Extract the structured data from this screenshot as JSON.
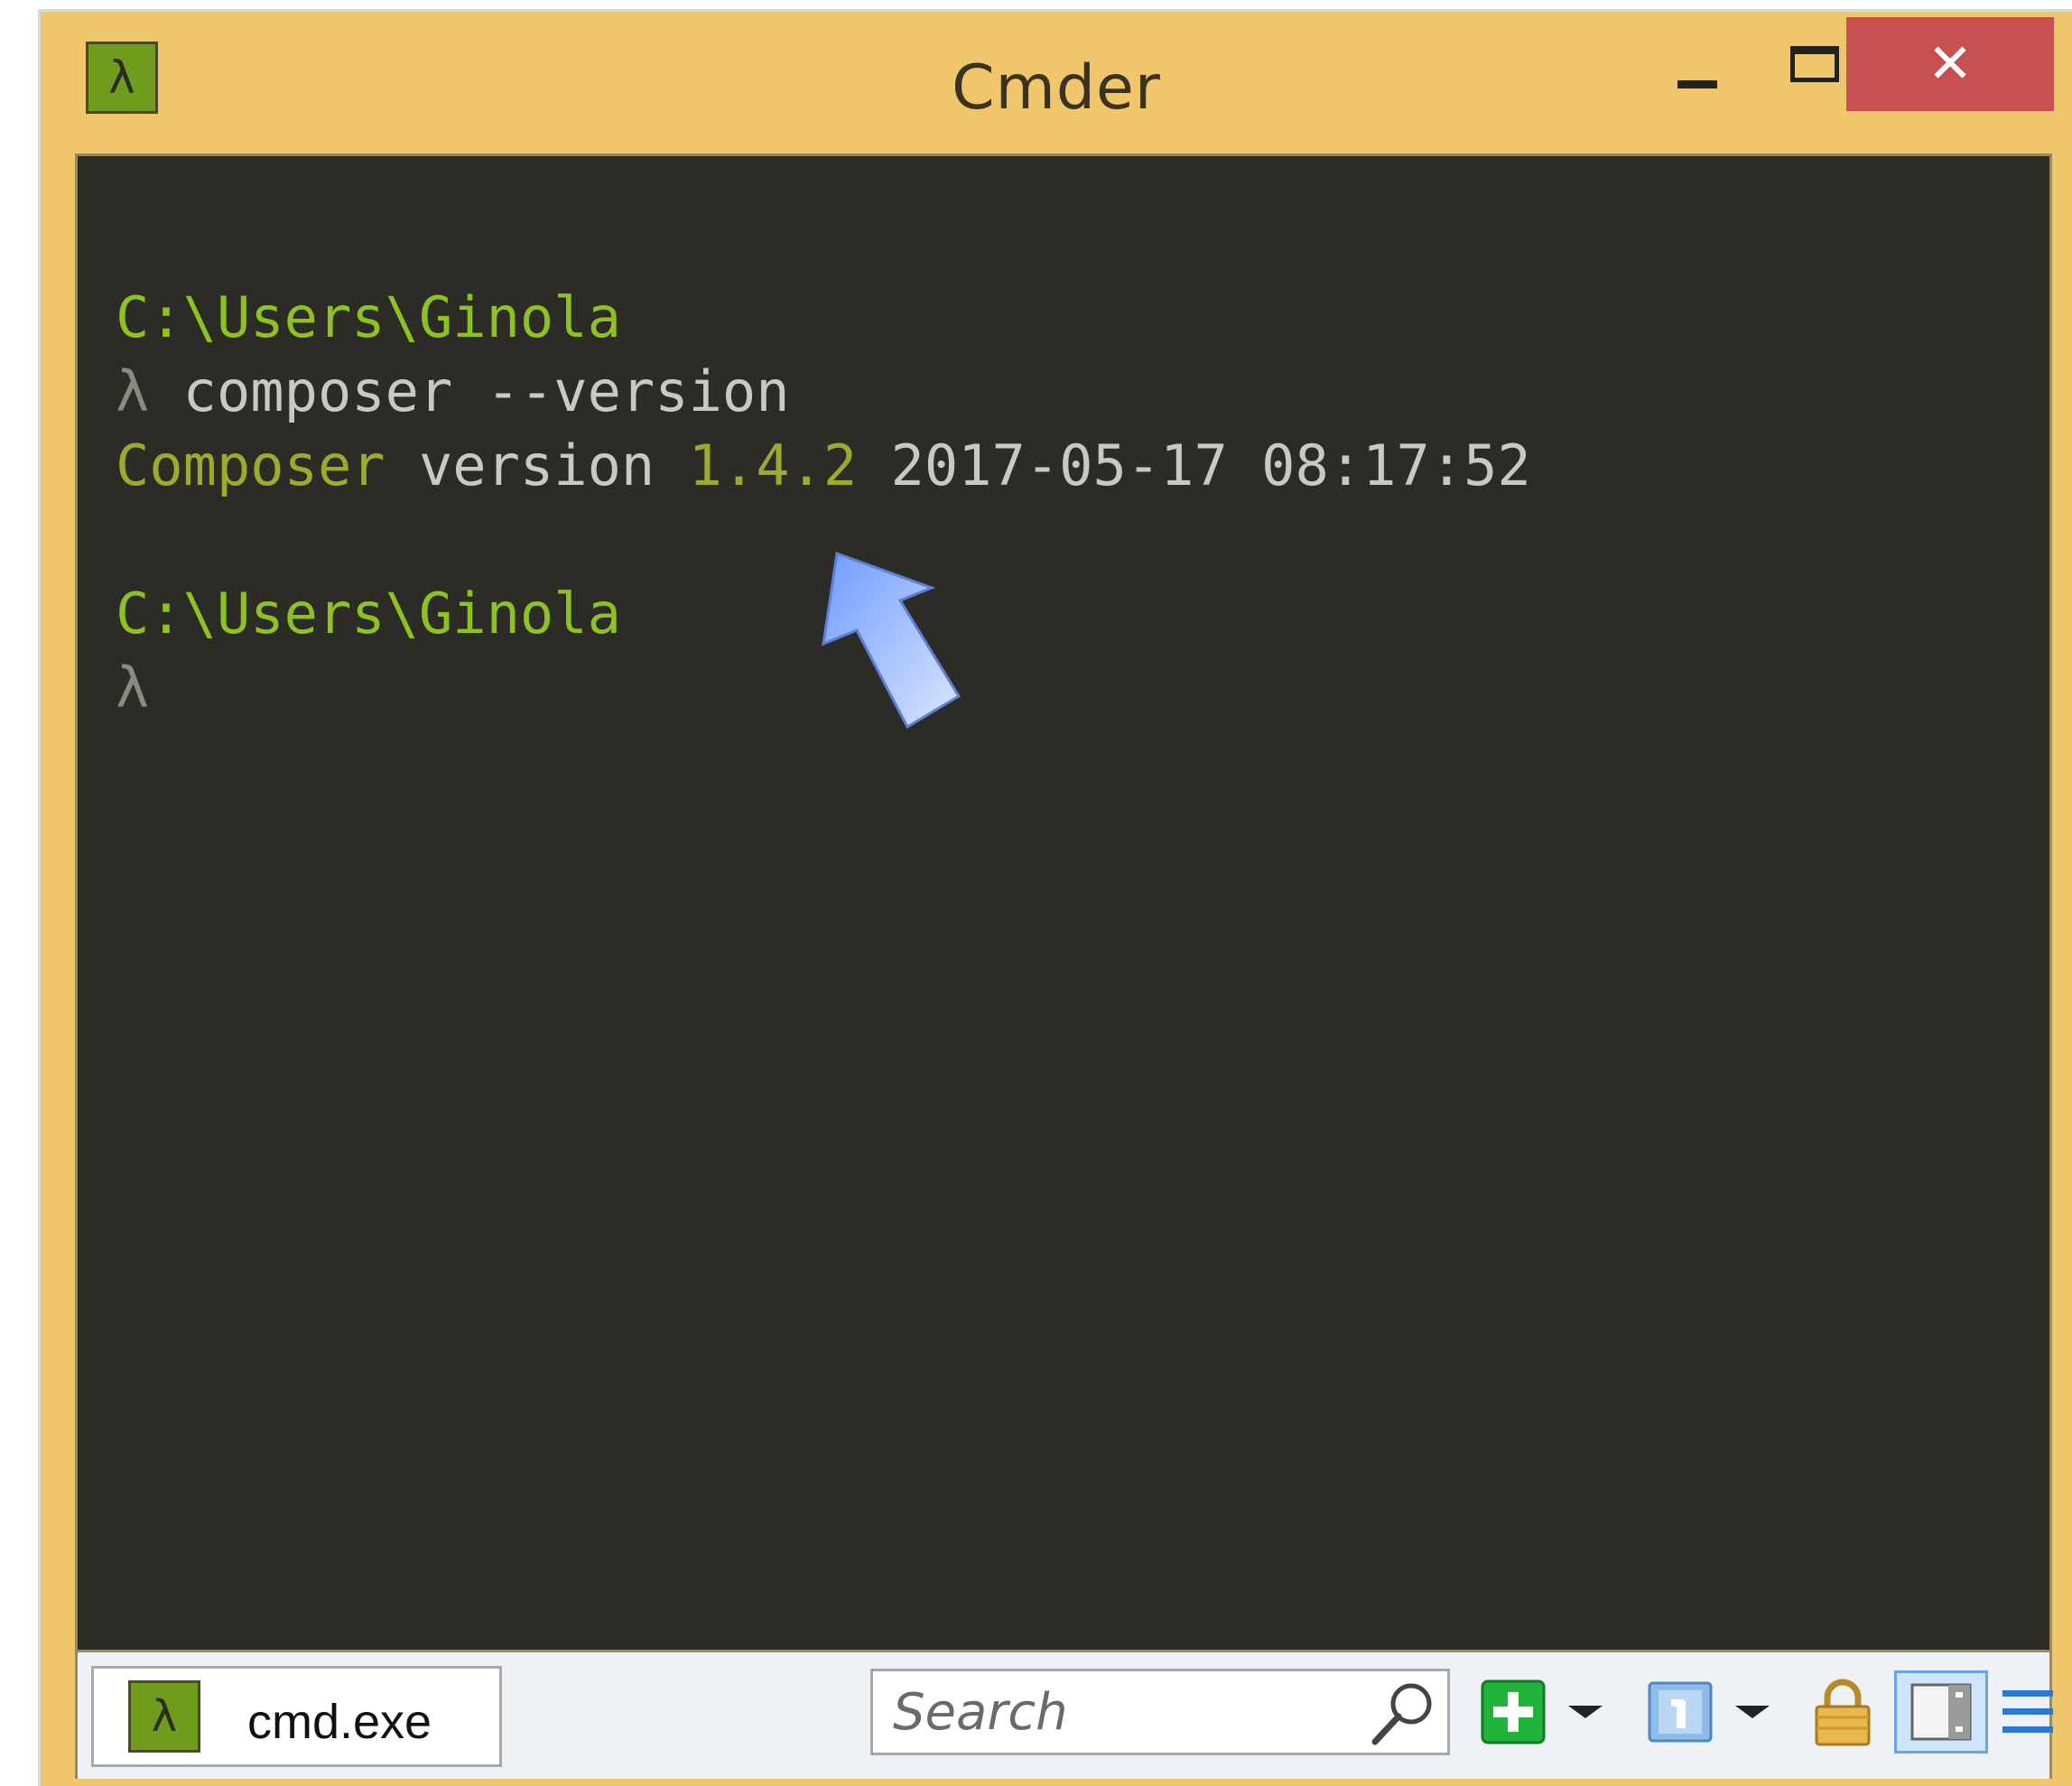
{
  "window": {
    "title": "Cmder",
    "app_icon_glyph": "λ",
    "close_glyph": "✕"
  },
  "console": {
    "lines": [
      {
        "segments": [
          {
            "text": "C:\\Users\\Ginola",
            "class": "green"
          }
        ]
      },
      {
        "segments": [
          {
            "text": "λ ",
            "class": "dim"
          },
          {
            "text": "composer --version",
            "class": "grey"
          }
        ]
      },
      {
        "segments": [
          {
            "text": "Composer",
            "class": "olive"
          },
          {
            "text": " version ",
            "class": "grey"
          },
          {
            "text": "1.4.2",
            "class": "olive"
          },
          {
            "text": " 2017-05-17 08:17:52",
            "class": "grey"
          }
        ]
      },
      {
        "segments": [
          {
            "text": "",
            "class": "grey"
          }
        ]
      },
      {
        "segments": [
          {
            "text": "C:\\Users\\Ginola",
            "class": "green"
          }
        ]
      },
      {
        "segments": [
          {
            "text": "λ",
            "class": "dim"
          }
        ]
      }
    ]
  },
  "statusbar": {
    "tab": {
      "label": "cmd.exe",
      "icon_glyph": "λ"
    },
    "search": {
      "placeholder": "Search",
      "value": ""
    },
    "icons": {
      "new_console": "plus-icon",
      "new_console_menu": "chevron-down-icon",
      "console_info": "info-icon",
      "console_info_menu": "chevron-down-icon",
      "lock": "lock-icon",
      "split": "split-view-icon",
      "menu": "hamburger-menu-icon"
    }
  },
  "colors": {
    "frame": "#f0c66c",
    "console_bg": "#2c2b26",
    "prompt_green": "#8dc21f",
    "close_red": "#c75050",
    "arrow_blue": "#8fb3ff"
  }
}
